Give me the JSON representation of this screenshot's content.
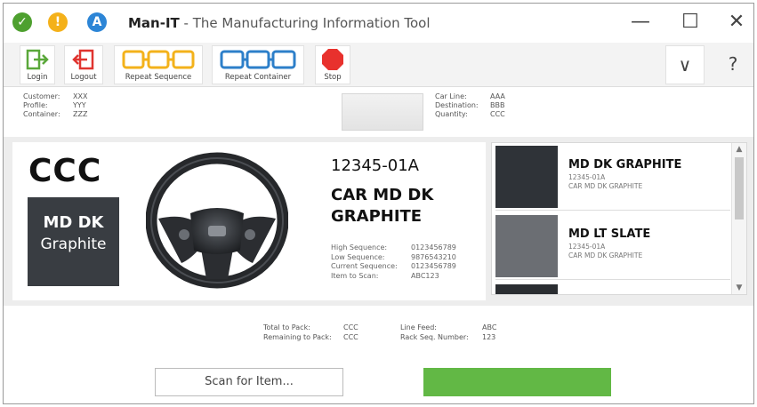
{
  "title": {
    "app": "Man-IT",
    "separator": " - ",
    "subtitle": "The Manufacturing Information Tool"
  },
  "title_icons": [
    {
      "name": "check",
      "glyph": "✓",
      "color": "#4ea02f"
    },
    {
      "name": "warning",
      "glyph": "!",
      "color": "#f4b11a"
    },
    {
      "name": "app-logo",
      "glyph": "A",
      "color": "#2c85d6"
    }
  ],
  "window_controls": {
    "minimize": "—",
    "maximize": "☐",
    "close": "✕"
  },
  "toolbar": {
    "login": "Login",
    "logout": "Logout",
    "repeat_sequence": "Repeat Sequence",
    "repeat_container": "Repeat Container",
    "stop": "Stop",
    "expand": "∨",
    "help": "?"
  },
  "info_left": [
    {
      "label": "Customer:",
      "value": "XXX"
    },
    {
      "label": "Profile:",
      "value": "YYY"
    },
    {
      "label": "Container:",
      "value": "ZZZ"
    }
  ],
  "info_right": [
    {
      "label": "Car Line:",
      "value": "AAA"
    },
    {
      "label": "Destination:",
      "value": "BBB"
    },
    {
      "label": "Quantity:",
      "value": "CCC"
    }
  ],
  "item": {
    "code": "CCC",
    "swatch_line1": "MD DK",
    "swatch_line2": "Graphite",
    "part_number": "12345-01A",
    "part_name": "CAR MD DK GRAPHITE",
    "sequences": [
      {
        "label": "High Sequence:",
        "value": "0123456789"
      },
      {
        "label": "Low Sequence:",
        "value": "9876543210"
      },
      {
        "label": "Current Sequence:",
        "value": "0123456789"
      },
      {
        "label": "Item to Scan:",
        "value": "ABC123"
      }
    ]
  },
  "color_list": [
    {
      "title": "MD DK GRAPHITE",
      "part": "12345-01A",
      "desc": "CAR MD DK GRAPHITE",
      "color": "#2f3338"
    },
    {
      "title": "MD LT SLATE",
      "part": "12345-01A",
      "desc": "CAR MD DK GRAPHITE",
      "color": "#6b6e73"
    },
    {
      "title": "",
      "part": "",
      "desc": "",
      "color": "#2a2d31"
    }
  ],
  "pack": {
    "total_label": "Total to Pack:",
    "total_value": "CCC",
    "remaining_label": "Remaining to Pack:",
    "remaining_value": "CCC",
    "line_feed_label": "Line Feed:",
    "line_feed_value": "ABC",
    "rack_label": "Rack Seq. Number:",
    "rack_value": "123"
  },
  "scan_button": "Scan for Item...",
  "colors": {
    "go_green": "#62b845",
    "stop_red": "#e8312d",
    "seq_orange": "#f3b21b",
    "container_blue": "#2d7fc9"
  }
}
